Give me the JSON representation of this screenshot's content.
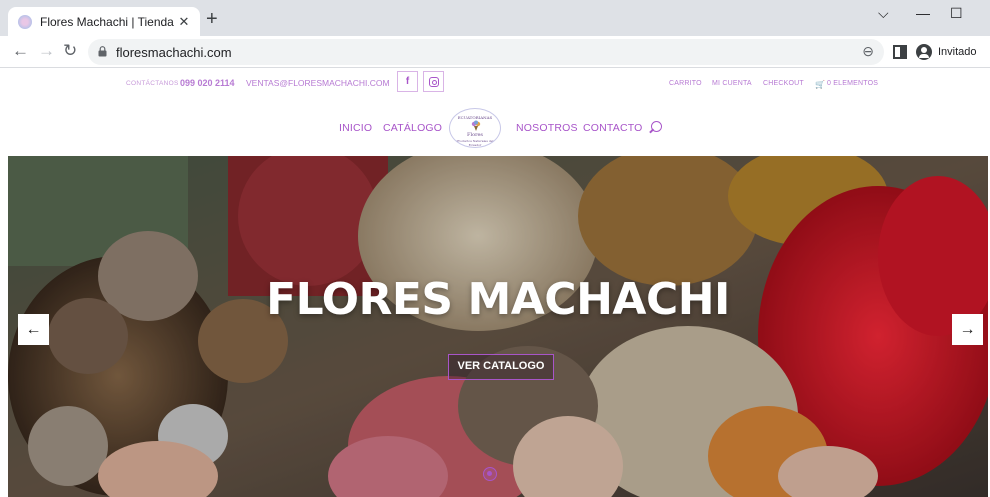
{
  "browser": {
    "tab_title": "Flores Machachi | Tienda Online",
    "tab_close": "✕",
    "new_tab": "+",
    "url": "floresmachachi.com",
    "profile_label": "Invitado",
    "controls": {
      "minimize": "—",
      "maximize": "☐",
      "collapse": "⌵"
    },
    "nav": {
      "back": "←",
      "forward": "→",
      "reload": "↻"
    },
    "zoom_glyph": "⊖"
  },
  "topbar": {
    "contact_prefix": "CONTÁCTANOS",
    "phone": "099 020 2114",
    "email": "VENTAS@FLORESMACHACHI.COM",
    "facebook_glyph": "f",
    "links": {
      "cart": "CARRITO",
      "account": "MI CUENTA",
      "checkout": "CHECKOUT",
      "items": "0 ELEMENTOS"
    },
    "cart_glyph": "🛒"
  },
  "nav": {
    "inicio": "INICIO",
    "catalogo": "CATÁLOGO",
    "nosotros": "NOSOTROS",
    "contacto": "CONTACTO"
  },
  "logo": {
    "top_text": "ECUATORIANAS",
    "name": "Flores",
    "tagline": "Productos Naturales del Ecuador"
  },
  "hero": {
    "title": "FLORES MACHACHI",
    "cta": "VER CATALOGO",
    "prev": "←",
    "next": "→"
  },
  "colors": {
    "brand_purple": "#a855c9",
    "brand_purple_light": "#b77ad3"
  }
}
